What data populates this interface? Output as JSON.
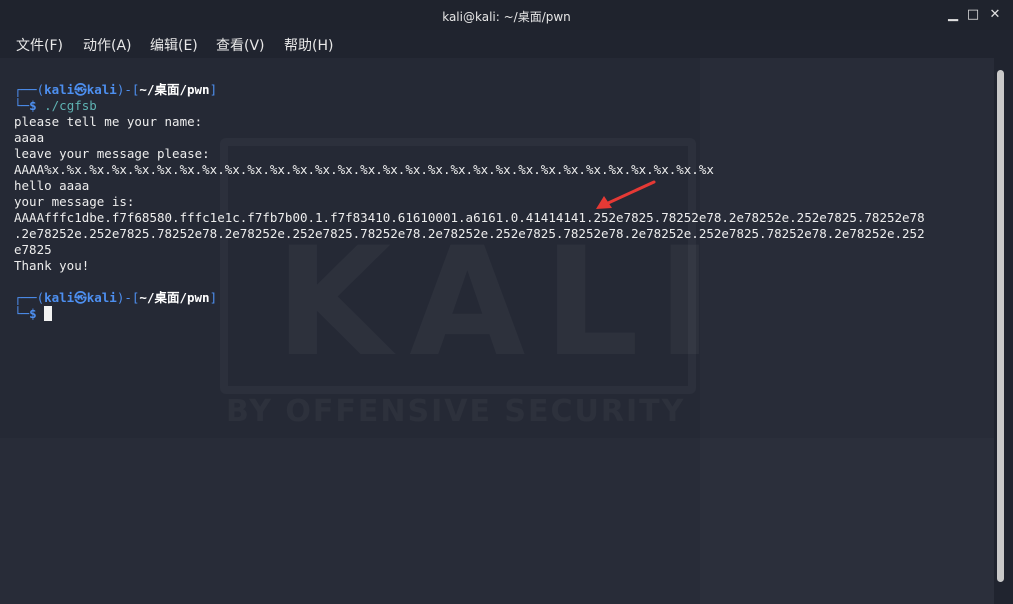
{
  "window": {
    "title": "kali@kali: ~/桌面/pwn",
    "minimize_glyph": "▁",
    "maximize_glyph": "□",
    "close_glyph": "✕"
  },
  "menu": {
    "items": [
      {
        "label": "文件(F)"
      },
      {
        "label": "动作(A)"
      },
      {
        "label": "编辑(E)"
      },
      {
        "label": "查看(V)"
      },
      {
        "label": "帮助(H)"
      }
    ]
  },
  "watermark": {
    "logo": "KALI",
    "tagline": "BY OFFENSIVE SECURITY"
  },
  "terminal": {
    "prompt1": {
      "corner_top": "┌──(",
      "user": "kali",
      "at": "㉿",
      "host": "kali",
      "mid": ")-[",
      "path": "~/桌面/pwn",
      "end": "]",
      "corner_bottom": "└─",
      "dollar": "$",
      "command": "./cgfsb"
    },
    "output": [
      "please tell me your name:",
      "aaaa",
      "leave your message please:",
      "AAAA%x.%x.%x.%x.%x.%x.%x.%x.%x.%x.%x.%x.%x.%x.%x.%x.%x.%x.%x.%x.%x.%x.%x.%x.%x.%x.%x.%x.%x.%x",
      "hello aaaa",
      "your message is:",
      "AAAAfffc1dbe.f7f68580.fffc1e1c.f7fb7b00.1.f7f83410.61610001.a6161.0.41414141.252e7825.78252e78.2e78252e.252e7825.78252e78",
      ".2e78252e.252e7825.78252e78.2e78252e.252e7825.78252e78.2e78252e.252e7825.78252e78.2e78252e.252e7825.78252e78.2e78252e.252",
      "e7825",
      "Thank you!"
    ],
    "prompt2": {
      "corner_top": "┌──(",
      "user": "kali",
      "at": "㉿",
      "host": "kali",
      "mid": ")-[",
      "path": "~/桌面/pwn",
      "end": "]",
      "corner_bottom": "└─",
      "dollar": "$"
    }
  },
  "colors": {
    "prompt_blue": "#4d8ff0",
    "command_teal": "#5fb3b3",
    "arrow_red": "#e53935"
  }
}
